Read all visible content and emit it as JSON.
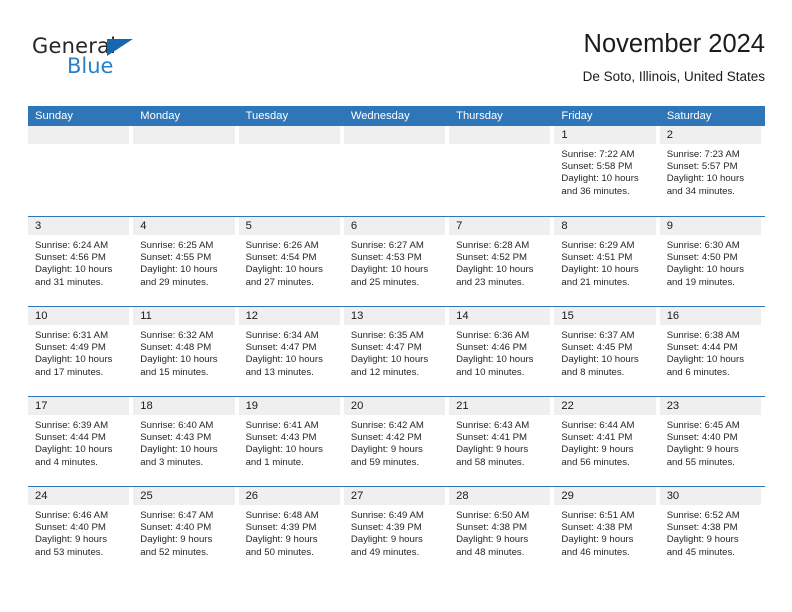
{
  "logo": {
    "word_top": "General",
    "word_bottom": "Blue",
    "triangle_color": "#1667b0",
    "blue_text_color": "#2a7fc9"
  },
  "header": {
    "title": "November 2024",
    "subtitle": "De Soto, Illinois, United States"
  },
  "theme": {
    "header_blue": "#2f76b8",
    "daynum_band": "#efefef",
    "row_divider": "#2f76b8"
  },
  "calendar": {
    "weekday_headers": [
      "Sunday",
      "Monday",
      "Tuesday",
      "Wednesday",
      "Thursday",
      "Friday",
      "Saturday"
    ],
    "weeks": [
      [
        {
          "day": "",
          "lines": []
        },
        {
          "day": "",
          "lines": []
        },
        {
          "day": "",
          "lines": []
        },
        {
          "day": "",
          "lines": []
        },
        {
          "day": "",
          "lines": []
        },
        {
          "day": "1",
          "lines": [
            "Sunrise: 7:22 AM",
            "Sunset: 5:58 PM",
            "Daylight: 10 hours",
            "and 36 minutes."
          ]
        },
        {
          "day": "2",
          "lines": [
            "Sunrise: 7:23 AM",
            "Sunset: 5:57 PM",
            "Daylight: 10 hours",
            "and 34 minutes."
          ]
        }
      ],
      [
        {
          "day": "3",
          "lines": [
            "Sunrise: 6:24 AM",
            "Sunset: 4:56 PM",
            "Daylight: 10 hours",
            "and 31 minutes."
          ]
        },
        {
          "day": "4",
          "lines": [
            "Sunrise: 6:25 AM",
            "Sunset: 4:55 PM",
            "Daylight: 10 hours",
            "and 29 minutes."
          ]
        },
        {
          "day": "5",
          "lines": [
            "Sunrise: 6:26 AM",
            "Sunset: 4:54 PM",
            "Daylight: 10 hours",
            "and 27 minutes."
          ]
        },
        {
          "day": "6",
          "lines": [
            "Sunrise: 6:27 AM",
            "Sunset: 4:53 PM",
            "Daylight: 10 hours",
            "and 25 minutes."
          ]
        },
        {
          "day": "7",
          "lines": [
            "Sunrise: 6:28 AM",
            "Sunset: 4:52 PM",
            "Daylight: 10 hours",
            "and 23 minutes."
          ]
        },
        {
          "day": "8",
          "lines": [
            "Sunrise: 6:29 AM",
            "Sunset: 4:51 PM",
            "Daylight: 10 hours",
            "and 21 minutes."
          ]
        },
        {
          "day": "9",
          "lines": [
            "Sunrise: 6:30 AM",
            "Sunset: 4:50 PM",
            "Daylight: 10 hours",
            "and 19 minutes."
          ]
        }
      ],
      [
        {
          "day": "10",
          "lines": [
            "Sunrise: 6:31 AM",
            "Sunset: 4:49 PM",
            "Daylight: 10 hours",
            "and 17 minutes."
          ]
        },
        {
          "day": "11",
          "lines": [
            "Sunrise: 6:32 AM",
            "Sunset: 4:48 PM",
            "Daylight: 10 hours",
            "and 15 minutes."
          ]
        },
        {
          "day": "12",
          "lines": [
            "Sunrise: 6:34 AM",
            "Sunset: 4:47 PM",
            "Daylight: 10 hours",
            "and 13 minutes."
          ]
        },
        {
          "day": "13",
          "lines": [
            "Sunrise: 6:35 AM",
            "Sunset: 4:47 PM",
            "Daylight: 10 hours",
            "and 12 minutes."
          ]
        },
        {
          "day": "14",
          "lines": [
            "Sunrise: 6:36 AM",
            "Sunset: 4:46 PM",
            "Daylight: 10 hours",
            "and 10 minutes."
          ]
        },
        {
          "day": "15",
          "lines": [
            "Sunrise: 6:37 AM",
            "Sunset: 4:45 PM",
            "Daylight: 10 hours",
            "and 8 minutes."
          ]
        },
        {
          "day": "16",
          "lines": [
            "Sunrise: 6:38 AM",
            "Sunset: 4:44 PM",
            "Daylight: 10 hours",
            "and 6 minutes."
          ]
        }
      ],
      [
        {
          "day": "17",
          "lines": [
            "Sunrise: 6:39 AM",
            "Sunset: 4:44 PM",
            "Daylight: 10 hours",
            "and 4 minutes."
          ]
        },
        {
          "day": "18",
          "lines": [
            "Sunrise: 6:40 AM",
            "Sunset: 4:43 PM",
            "Daylight: 10 hours",
            "and 3 minutes."
          ]
        },
        {
          "day": "19",
          "lines": [
            "Sunrise: 6:41 AM",
            "Sunset: 4:43 PM",
            "Daylight: 10 hours",
            "and 1 minute."
          ]
        },
        {
          "day": "20",
          "lines": [
            "Sunrise: 6:42 AM",
            "Sunset: 4:42 PM",
            "Daylight: 9 hours",
            "and 59 minutes."
          ]
        },
        {
          "day": "21",
          "lines": [
            "Sunrise: 6:43 AM",
            "Sunset: 4:41 PM",
            "Daylight: 9 hours",
            "and 58 minutes."
          ]
        },
        {
          "day": "22",
          "lines": [
            "Sunrise: 6:44 AM",
            "Sunset: 4:41 PM",
            "Daylight: 9 hours",
            "and 56 minutes."
          ]
        },
        {
          "day": "23",
          "lines": [
            "Sunrise: 6:45 AM",
            "Sunset: 4:40 PM",
            "Daylight: 9 hours",
            "and 55 minutes."
          ]
        }
      ],
      [
        {
          "day": "24",
          "lines": [
            "Sunrise: 6:46 AM",
            "Sunset: 4:40 PM",
            "Daylight: 9 hours",
            "and 53 minutes."
          ]
        },
        {
          "day": "25",
          "lines": [
            "Sunrise: 6:47 AM",
            "Sunset: 4:40 PM",
            "Daylight: 9 hours",
            "and 52 minutes."
          ]
        },
        {
          "day": "26",
          "lines": [
            "Sunrise: 6:48 AM",
            "Sunset: 4:39 PM",
            "Daylight: 9 hours",
            "and 50 minutes."
          ]
        },
        {
          "day": "27",
          "lines": [
            "Sunrise: 6:49 AM",
            "Sunset: 4:39 PM",
            "Daylight: 9 hours",
            "and 49 minutes."
          ]
        },
        {
          "day": "28",
          "lines": [
            "Sunrise: 6:50 AM",
            "Sunset: 4:38 PM",
            "Daylight: 9 hours",
            "and 48 minutes."
          ]
        },
        {
          "day": "29",
          "lines": [
            "Sunrise: 6:51 AM",
            "Sunset: 4:38 PM",
            "Daylight: 9 hours",
            "and 46 minutes."
          ]
        },
        {
          "day": "30",
          "lines": [
            "Sunrise: 6:52 AM",
            "Sunset: 4:38 PM",
            "Daylight: 9 hours",
            "and 45 minutes."
          ]
        }
      ]
    ]
  }
}
